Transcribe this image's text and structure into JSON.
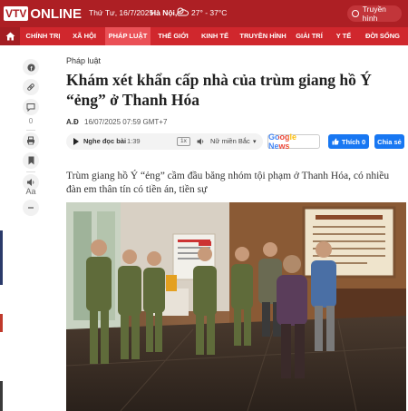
{
  "header": {
    "logo_vtv": "VTV",
    "logo_online": "ONLINE",
    "date": "Thứ Tư, 16/7/2025",
    "city": "Hà Nội,",
    "temperature": "27° - 37°C",
    "tv_button": "Truyền hình"
  },
  "nav": {
    "items": [
      "CHÍNH TRỊ",
      "XÃ HỘI",
      "PHÁP LUẬT",
      "THẾ GIỚI",
      "KINH TẾ",
      "TRUYỀN HÌNH",
      "GIẢI TRÍ",
      "Y TẾ",
      "ĐỜI SỐNG"
    ],
    "active": "PHÁP LUẬT"
  },
  "sidebar": {
    "comment_count": "0",
    "font_size_label": "Aa"
  },
  "article": {
    "category": "Pháp luật",
    "title": "Khám xét khẩn cấp nhà của trùm giang hồ Ý “ẻng” ở Thanh Hóa",
    "author": "A.Đ",
    "datetime": "16/07/2025 07:59 GMT+7",
    "lead": "Trùm giang hồ Ý “ẻng” cầm đầu băng nhóm tội phạm ở Thanh Hóa, có nhiều đàn em thân tín có tiền án, tiền sự"
  },
  "audio": {
    "label": "Nghe đọc bài",
    "time": "1:39",
    "speed": "1x",
    "voice": "Nữ miền Bắc"
  },
  "social": {
    "google_news": "Google News",
    "like": "Thích 0",
    "share": "Chia sẻ"
  },
  "colors": {
    "brand_red": "#ad1f24",
    "nav_red": "#d0272d",
    "nav_active": "#ea5056",
    "facebook_blue": "#1877f2"
  }
}
